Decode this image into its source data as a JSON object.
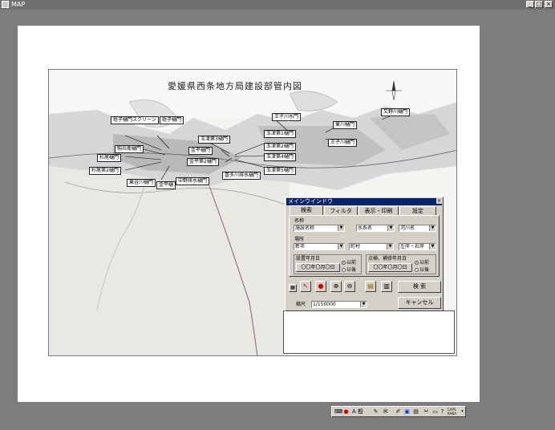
{
  "window": {
    "title": "MAP",
    "min": "_",
    "max": "□",
    "close": "×"
  },
  "map": {
    "title": "愛媛県西条地方局建設部管内図",
    "gates": [
      "蛭子樋門スクリーン",
      "蛭子樋門",
      "駒兵衛樋門",
      "杉尾樋門",
      "杉尾第2樋門",
      "東谷川樋門",
      "金平樋門",
      "中野排水樋門",
      "金平第2樋門",
      "金平樋",
      "玉津第3樋門",
      "玉津第1樋門",
      "玉津第2樋門",
      "玉津第4樋門",
      "玉津第5樋門",
      "王子川水門",
      "喜多川排水樋門",
      "東川樋門",
      "王子川樋門",
      "又野川樋門"
    ]
  },
  "dialog": {
    "title": "メインウインドウ",
    "close": "×",
    "tabs": [
      "検索",
      "フィルタ",
      "表示・印刷",
      "設定"
    ],
    "name_label": "名称",
    "name_fields": [
      "施設名称",
      "水系名",
      "河川名"
    ],
    "place_label": "場所",
    "place_fields": [
      "新市",
      "町村",
      "左岸・右岸"
    ],
    "date1_label": "設置年月日",
    "date1_value": "〇〇年〇月〇日",
    "date1_radio": [
      "以前",
      "以後"
    ],
    "date2_label": "点検、補修年月日",
    "date2_value": "〇〇年〇月〇日",
    "date2_radio": [
      "以前",
      "以後"
    ],
    "search_button": "検 索",
    "cancel_button": "キャンセル",
    "scale_label": "縮尺",
    "scale_value": "1/150000"
  },
  "tray": {
    "ime_mode": "A 般",
    "caps": "CAPS",
    "kana": "KANA"
  }
}
